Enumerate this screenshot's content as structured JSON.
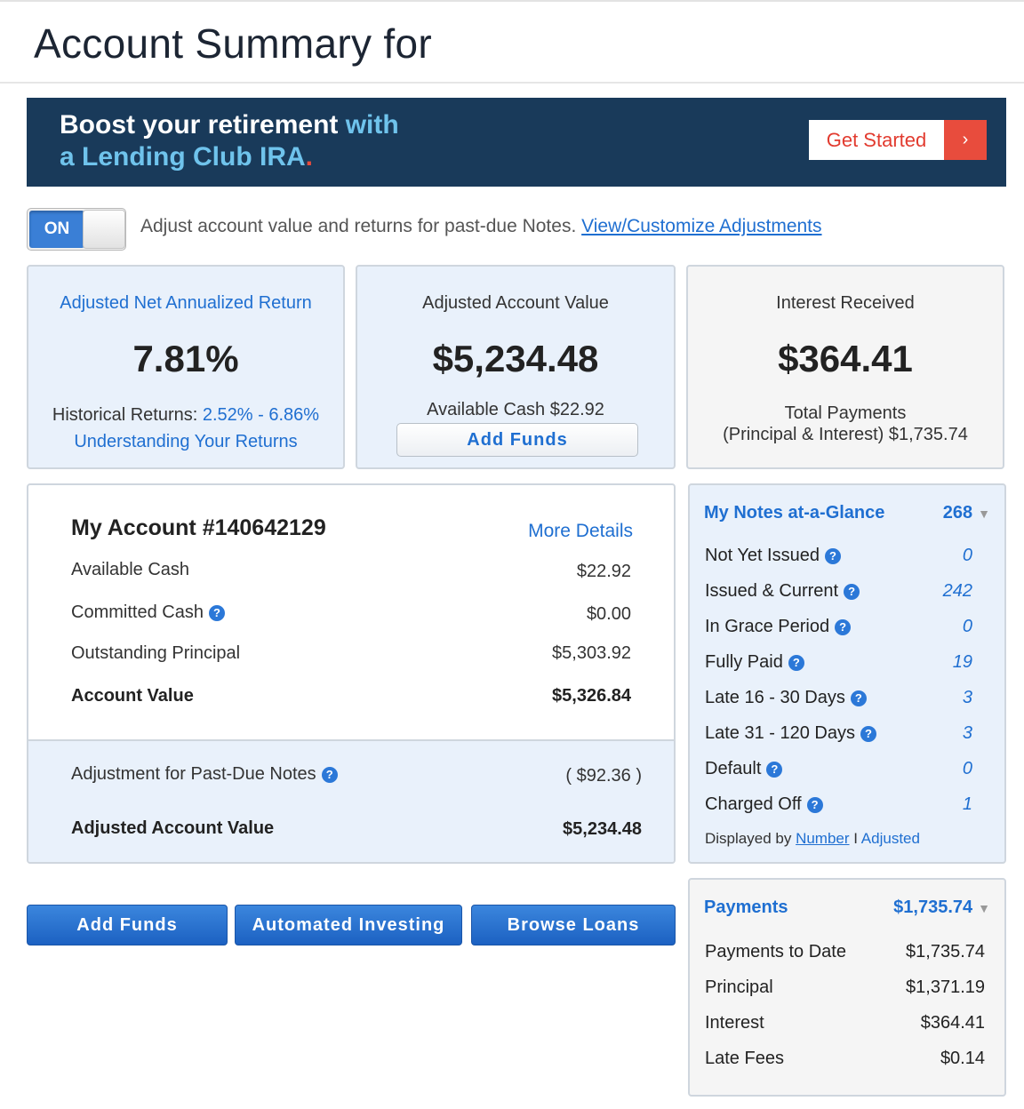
{
  "page": {
    "title": "Account Summary for"
  },
  "banner": {
    "line1_white": "Boost your retirement",
    "line1_blue": " with",
    "line2_blue": "a Lending Club IRA",
    "line2_dot": ".",
    "cta_label": "Get Started",
    "cta_arrow": "›"
  },
  "toggle": {
    "state_label": "ON",
    "description": "Adjust account value and returns for past-due Notes.",
    "link": "View/Customize Adjustments"
  },
  "cards": {
    "return": {
      "label": "Adjusted Net Annualized Return",
      "value": "7.81%",
      "historical_label": "Historical Returns:",
      "historical_range": "2.52% - 6.86%",
      "understanding_link": "Understanding Your Returns"
    },
    "value": {
      "label": "Adjusted Account Value",
      "amount": "$5,234.48",
      "available_cash": "Available Cash $22.92",
      "button": "Add Funds"
    },
    "interest": {
      "label": "Interest Received",
      "amount": "$364.41",
      "total_line1": "Total Payments",
      "total_line2": "(Principal & Interest) $1,735.74"
    }
  },
  "account": {
    "title": "My Account #140642129",
    "more_details": "More Details",
    "rows": [
      {
        "label": "Available Cash",
        "value": "$22.92"
      },
      {
        "label": "Committed Cash",
        "value": "$0.00"
      },
      {
        "label": "Outstanding Principal",
        "value": "$5,303.92"
      },
      {
        "label": "Account Value",
        "value": "$5,326.84"
      }
    ],
    "adjustment": {
      "label": "Adjustment for Past-Due Notes",
      "value": "( $92.36 )"
    },
    "adjusted": {
      "label": "Adjusted Account Value",
      "value": "$5,234.48"
    }
  },
  "help_glyph": "?",
  "actions": {
    "add_funds": "Add Funds",
    "automated_investing": "Automated Investing",
    "browse_loans": "Browse Loans"
  },
  "notes": {
    "title": "My Notes at-a-Glance",
    "total": "268",
    "caret": "▼",
    "rows": [
      {
        "label": "Not Yet Issued",
        "count": "0"
      },
      {
        "label": "Issued & Current",
        "count": "242"
      },
      {
        "label": "In Grace Period",
        "count": "0"
      },
      {
        "label": "Fully Paid",
        "count": "19"
      },
      {
        "label": "Late 16 - 30 Days",
        "count": "3"
      },
      {
        "label": "Late 31 - 120 Days",
        "count": "3"
      },
      {
        "label": "Default",
        "count": "0"
      },
      {
        "label": "Charged Off",
        "count": "1"
      }
    ],
    "displayed_by": "Displayed by",
    "by_number": "Number",
    "separator": "I",
    "by_adjusted": "Adjusted"
  },
  "payments": {
    "title": "Payments",
    "total": "$1,735.74",
    "caret": "▼",
    "rows": [
      {
        "label": "Payments to Date",
        "value": "$1,735.74"
      },
      {
        "label": "Principal",
        "value": "$1,371.19"
      },
      {
        "label": "Interest",
        "value": "$364.41"
      },
      {
        "label": "Late Fees",
        "value": "$0.14"
      }
    ]
  }
}
